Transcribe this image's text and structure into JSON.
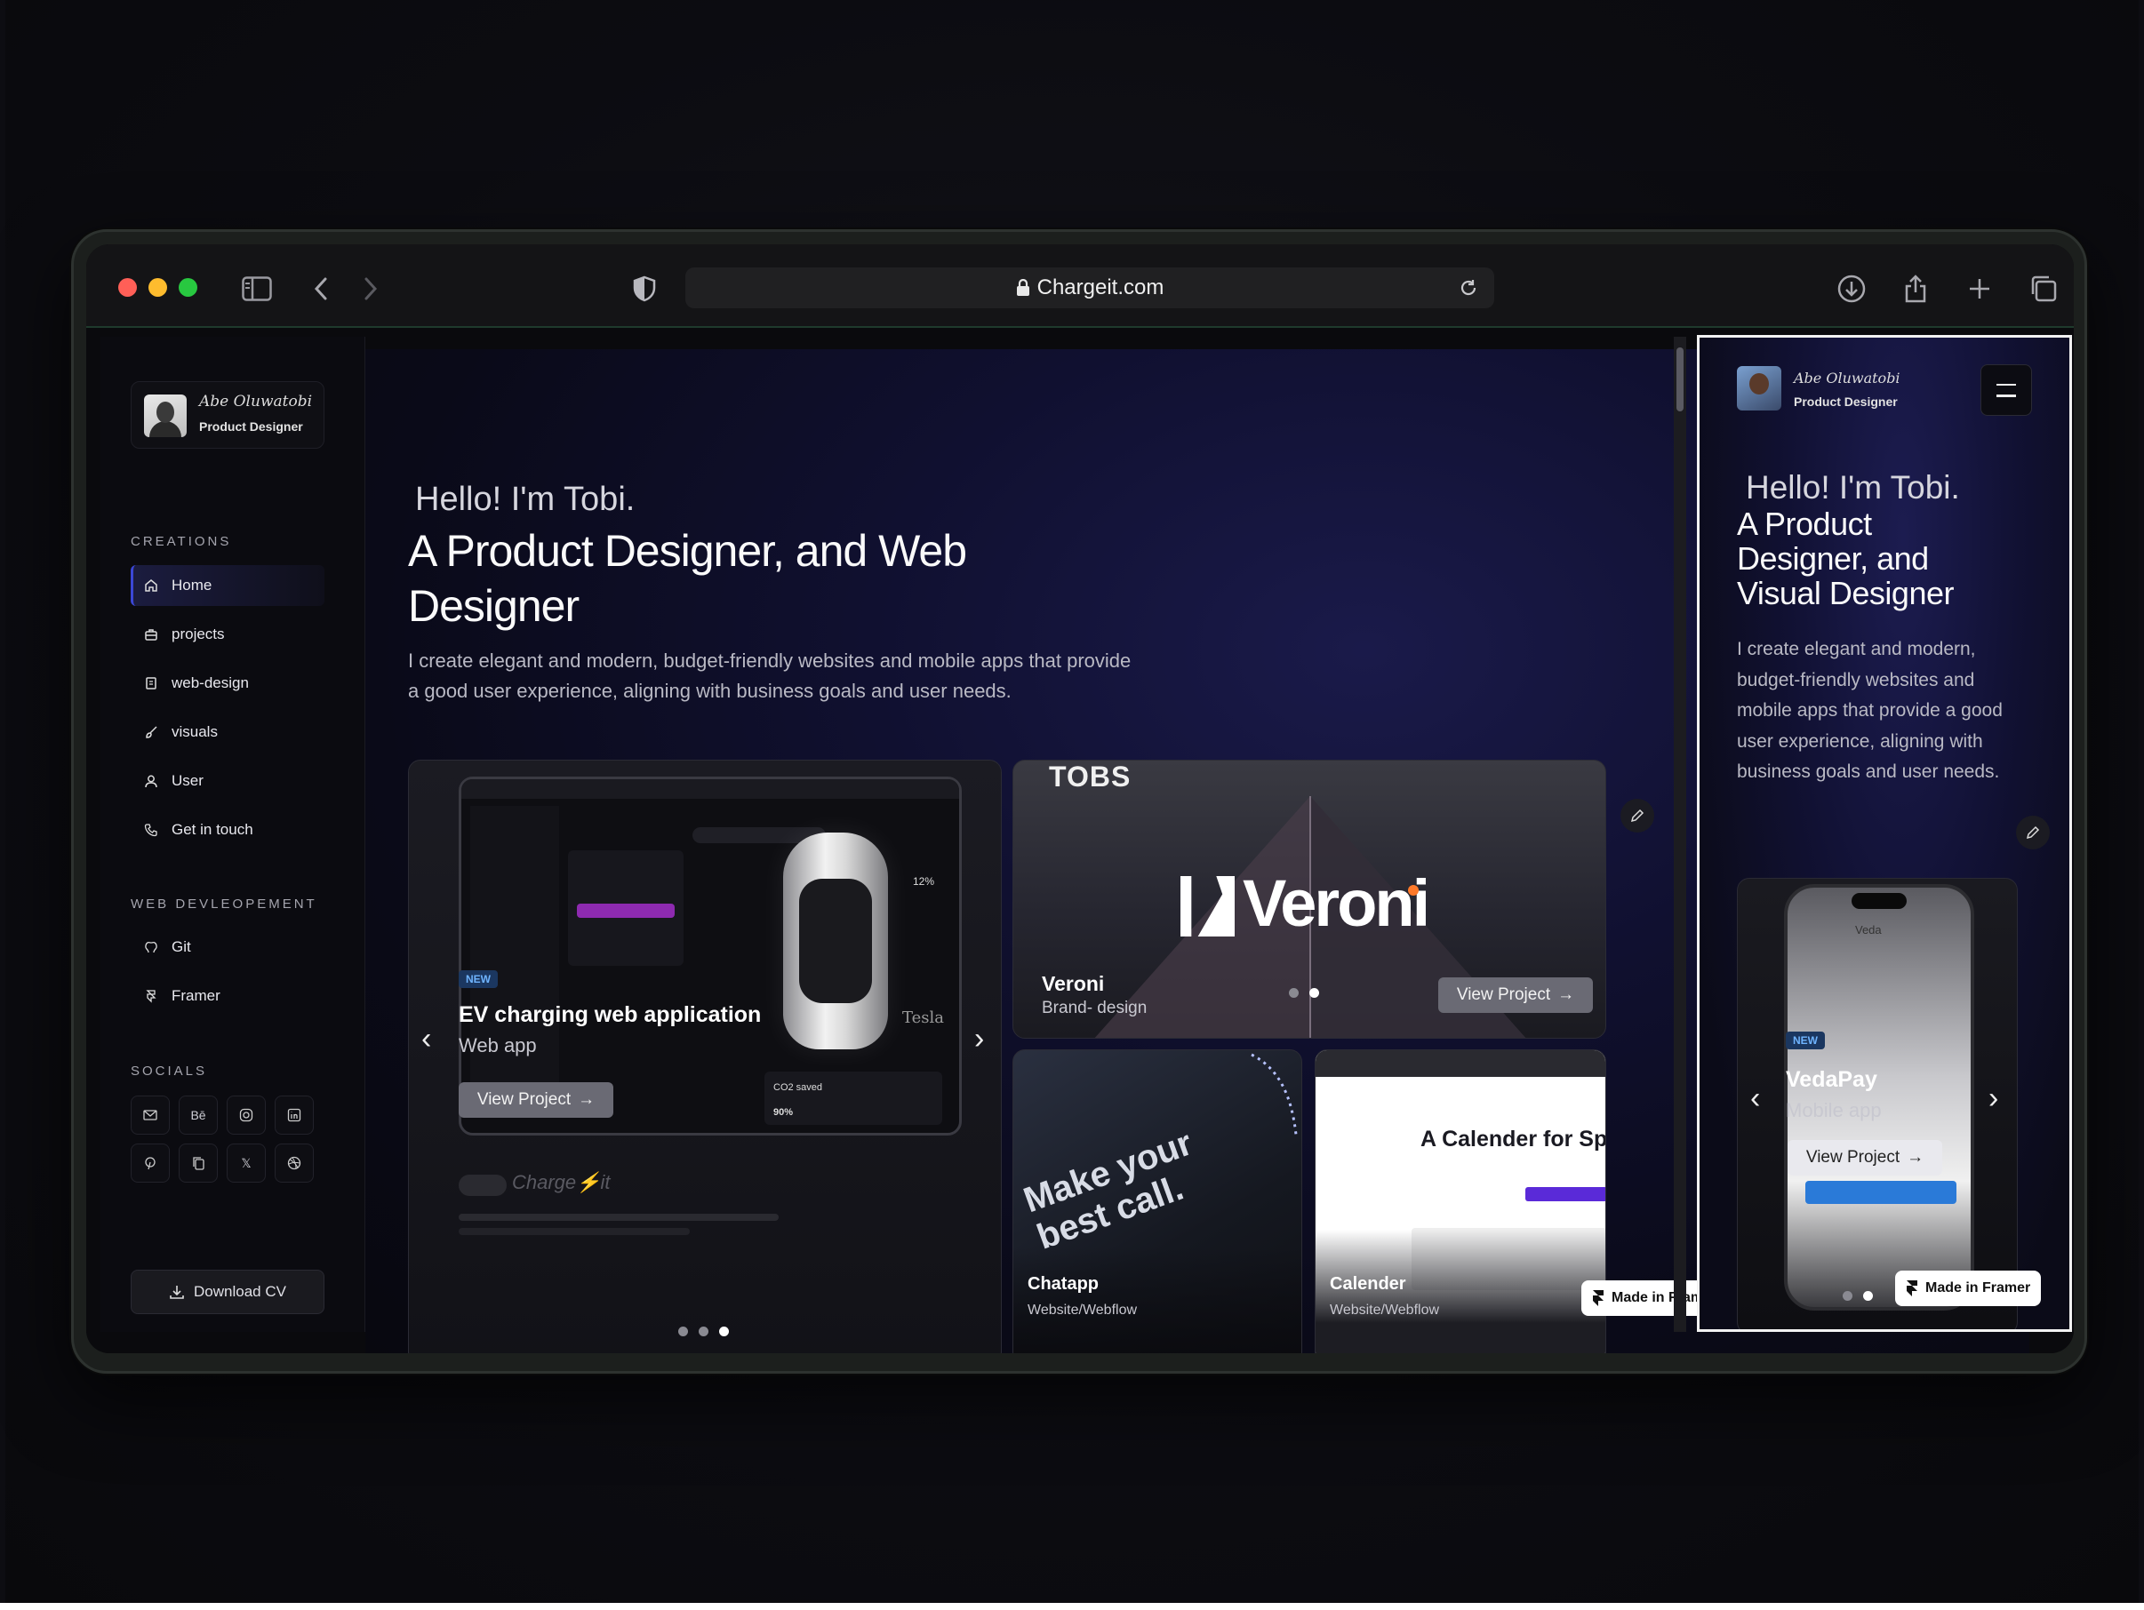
{
  "browser": {
    "url": "Chargeit.com",
    "traffic_light_colors": [
      "#ff5f57",
      "#febc2e",
      "#28c840"
    ]
  },
  "sidebar": {
    "profile": {
      "signature": "Abe Oluwatobi",
      "role": "Product Designer"
    },
    "creations_title": "CREATIONS",
    "creations": [
      {
        "label": "Home",
        "icon": "home-icon",
        "active": true
      },
      {
        "label": "projects",
        "icon": "briefcase-icon",
        "active": false
      },
      {
        "label": "web-design",
        "icon": "document-icon",
        "active": false
      },
      {
        "label": "visuals",
        "icon": "brush-icon",
        "active": false
      },
      {
        "label": "User",
        "icon": "user-icon",
        "active": false
      },
      {
        "label": "Get in touch",
        "icon": "phone-icon",
        "active": false
      }
    ],
    "webdev_title": "WEB DEVLEOPEMENT",
    "webdev": [
      {
        "label": "Git",
        "icon": "git-icon"
      },
      {
        "label": "Framer",
        "icon": "framer-icon"
      }
    ],
    "socials_title": "SOCIALS",
    "socials": [
      "mail-icon",
      "behance-icon",
      "instagram-icon",
      "linkedin-icon",
      "pinterest-icon",
      "copy-icon",
      "x-icon",
      "dribbble-icon"
    ],
    "behance_text": "Bē",
    "x_text": "𝕏",
    "download_label": "Download CV"
  },
  "hero": {
    "hello": "Hello! I'm Tobi.",
    "headline": "A Product Designer, and Web Designer",
    "intro": "I create elegant and modern, budget-friendly websites and mobile apps that provide a good user experience, aligning with business goals and user needs."
  },
  "projects": [
    {
      "badge": "NEW",
      "title": "EV charging web application",
      "subtitle": "Web app",
      "button": "View Project",
      "brand": "Charge⚡it",
      "stat_label": "CO2 saved",
      "stat_value": "90%",
      "gauge": "12%",
      "car": "Tesla"
    },
    {
      "logo": "TOBS",
      "brand": "Veroni",
      "title": "Veroni",
      "subtitle": "Brand- design",
      "button": "View Project"
    },
    {
      "title": "Chatapp",
      "subtitle": "Website/Webflow",
      "tagline": "Make your best call."
    },
    {
      "title": "Calender",
      "subtitle": "Website/Webflow",
      "headline": "A Calender for Sp"
    }
  ],
  "made_in_framer": "Made in Framer",
  "mobile": {
    "profile": {
      "signature": "Abe Oluwatobi",
      "role": "Product Designer"
    },
    "hello": "Hello! I'm Tobi.",
    "headline": "A Product Designer, and Visual Designer",
    "intro": "I create elegant and modern, budget-friendly websites and mobile apps that provide a good user experience, aligning with business goals and user needs.",
    "project": {
      "badge": "NEW",
      "title": "VedaPay",
      "subtitle": "Mobile app",
      "button": "View Project",
      "app_name": "Veda"
    }
  }
}
